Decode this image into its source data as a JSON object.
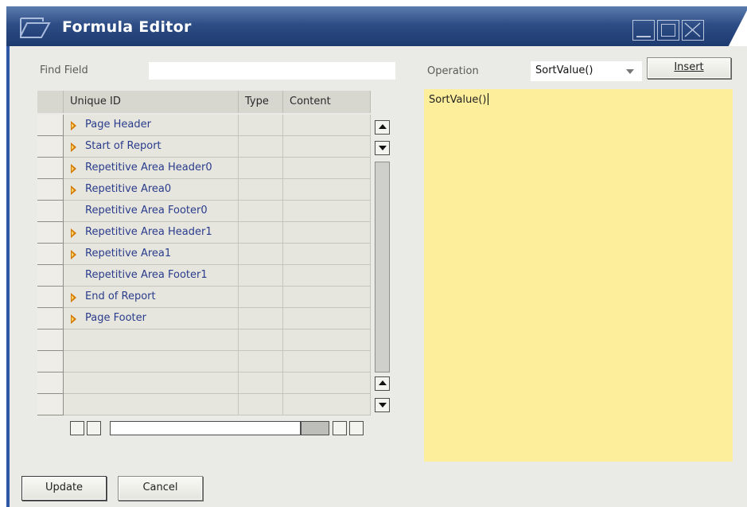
{
  "window": {
    "title": "Formula Editor"
  },
  "find": {
    "label": "Find Field",
    "value": ""
  },
  "grid": {
    "columns": [
      "Unique ID",
      "Type",
      "Content"
    ],
    "rows": [
      {
        "id": "Page Header",
        "type": "",
        "content": "",
        "expandable": true
      },
      {
        "id": "Start of Report",
        "type": "",
        "content": "",
        "expandable": true
      },
      {
        "id": "Repetitive Area Header0",
        "type": "",
        "content": "",
        "expandable": true
      },
      {
        "id": "Repetitive Area0",
        "type": "",
        "content": "",
        "expandable": true
      },
      {
        "id": "Repetitive Area Footer0",
        "type": "",
        "content": "",
        "expandable": false
      },
      {
        "id": "Repetitive Area Header1",
        "type": "",
        "content": "",
        "expandable": true
      },
      {
        "id": "Repetitive Area1",
        "type": "",
        "content": "",
        "expandable": true
      },
      {
        "id": "Repetitive Area Footer1",
        "type": "",
        "content": "",
        "expandable": false
      },
      {
        "id": "End of Report",
        "type": "",
        "content": "",
        "expandable": true
      },
      {
        "id": "Page Footer",
        "type": "",
        "content": "",
        "expandable": true
      },
      {
        "id": "",
        "type": "",
        "content": "",
        "expandable": false
      },
      {
        "id": "",
        "type": "",
        "content": "",
        "expandable": false
      },
      {
        "id": "",
        "type": "",
        "content": "",
        "expandable": false
      },
      {
        "id": "",
        "type": "",
        "content": "",
        "expandable": false
      }
    ]
  },
  "operation": {
    "label": "Operation",
    "selected": "SortValue()"
  },
  "buttons": {
    "insert_label": "Insert",
    "update_label": "Update",
    "cancel_label": "Cancel"
  },
  "formula": {
    "text": "SortValue()"
  },
  "icons": {
    "title": "document-icon",
    "expander": "triangle-right-icon",
    "minimize": "minimize-icon",
    "maximize": "maximize-icon",
    "close": "close-icon"
  },
  "colors": {
    "titlebar": "#2e4d86",
    "formula_background": "#fdee9c",
    "expander": "#d47a00",
    "row_text": "#2a3c8c"
  }
}
